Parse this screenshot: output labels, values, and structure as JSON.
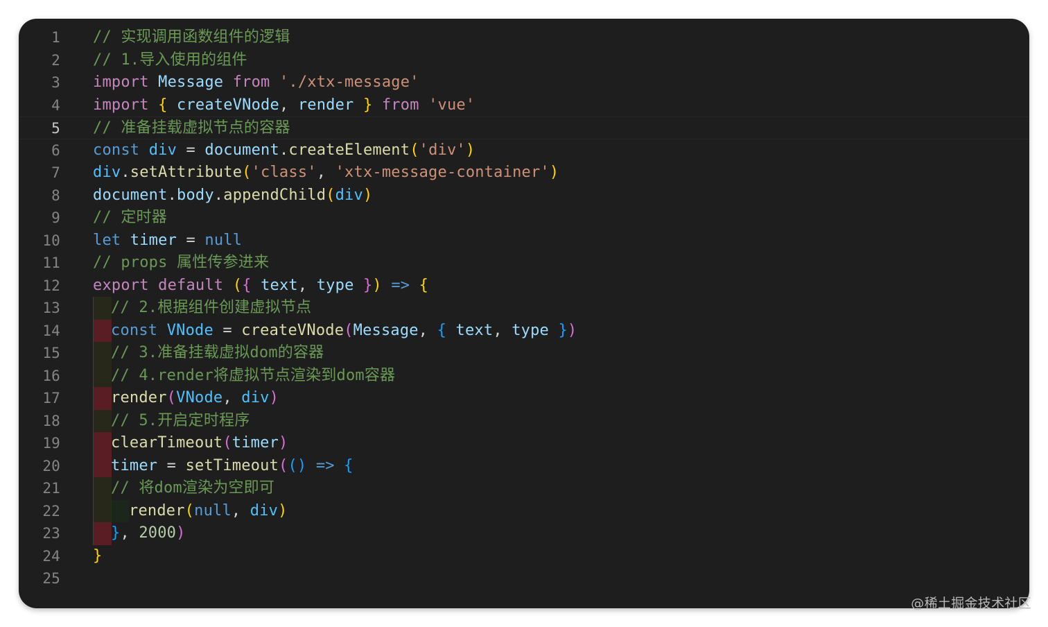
{
  "editor": {
    "lines": [
      {
        "n": "1",
        "indent": 0,
        "tokens": [
          [
            "c",
            "// 实现调用函数组件的逻辑"
          ]
        ]
      },
      {
        "n": "2",
        "indent": 0,
        "tokens": [
          [
            "c",
            "// 1.导入使用的组件"
          ]
        ]
      },
      {
        "n": "3",
        "indent": 0,
        "tokens": [
          [
            "k",
            "import"
          ],
          [
            "p",
            " "
          ],
          [
            "v",
            "Message"
          ],
          [
            "p",
            " "
          ],
          [
            "k",
            "from"
          ],
          [
            "p",
            " "
          ],
          [
            "s",
            "'./xtx-message'"
          ]
        ]
      },
      {
        "n": "4",
        "indent": 0,
        "tokens": [
          [
            "k",
            "import"
          ],
          [
            "p",
            " "
          ],
          [
            "b1",
            "{"
          ],
          [
            "p",
            " "
          ],
          [
            "v",
            "createVNode"
          ],
          [
            "p",
            ", "
          ],
          [
            "v",
            "render"
          ],
          [
            "p",
            " "
          ],
          [
            "b1",
            "}"
          ],
          [
            "p",
            " "
          ],
          [
            "k",
            "from"
          ],
          [
            "p",
            " "
          ],
          [
            "s",
            "'vue'"
          ]
        ]
      },
      {
        "n": "5",
        "indent": 0,
        "current": true,
        "tokens": [
          [
            "c",
            "// 准备挂载虚拟节点的容器"
          ]
        ]
      },
      {
        "n": "6",
        "indent": 0,
        "tokens": [
          [
            "d",
            "const"
          ],
          [
            "p",
            " "
          ],
          [
            "cn",
            "div"
          ],
          [
            "p",
            " = "
          ],
          [
            "v",
            "document"
          ],
          [
            "p",
            "."
          ],
          [
            "f",
            "createElement"
          ],
          [
            "b1",
            "("
          ],
          [
            "s",
            "'div'"
          ],
          [
            "b1",
            ")"
          ]
        ]
      },
      {
        "n": "7",
        "indent": 0,
        "tokens": [
          [
            "cn",
            "div"
          ],
          [
            "p",
            "."
          ],
          [
            "f",
            "setAttribute"
          ],
          [
            "b1",
            "("
          ],
          [
            "s",
            "'class'"
          ],
          [
            "p",
            ", "
          ],
          [
            "s",
            "'xtx-message-container'"
          ],
          [
            "b1",
            ")"
          ]
        ]
      },
      {
        "n": "8",
        "indent": 0,
        "tokens": [
          [
            "v",
            "document"
          ],
          [
            "p",
            "."
          ],
          [
            "v",
            "body"
          ],
          [
            "p",
            "."
          ],
          [
            "f",
            "appendChild"
          ],
          [
            "b1",
            "("
          ],
          [
            "cn",
            "div"
          ],
          [
            "b1",
            ")"
          ]
        ]
      },
      {
        "n": "9",
        "indent": 0,
        "tokens": [
          [
            "c",
            "// 定时器"
          ]
        ]
      },
      {
        "n": "10",
        "indent": 0,
        "tokens": [
          [
            "d",
            "let"
          ],
          [
            "p",
            " "
          ],
          [
            "v",
            "timer"
          ],
          [
            "p",
            " = "
          ],
          [
            "d",
            "null"
          ]
        ]
      },
      {
        "n": "11",
        "indent": 0,
        "tokens": [
          [
            "c",
            "// props 属性传参进来"
          ]
        ]
      },
      {
        "n": "12",
        "indent": 0,
        "tokens": [
          [
            "k",
            "export"
          ],
          [
            "p",
            " "
          ],
          [
            "k",
            "default"
          ],
          [
            "p",
            " "
          ],
          [
            "b1",
            "("
          ],
          [
            "b2",
            "{"
          ],
          [
            "p",
            " "
          ],
          [
            "v",
            "text"
          ],
          [
            "p",
            ", "
          ],
          [
            "v",
            "type"
          ],
          [
            "p",
            " "
          ],
          [
            "b2",
            "}"
          ],
          [
            "b1",
            ")"
          ],
          [
            "p",
            " "
          ],
          [
            "d",
            "=>"
          ],
          [
            "p",
            " "
          ],
          [
            "b1",
            "{"
          ]
        ]
      },
      {
        "n": "13",
        "indent": 1,
        "guide": "normal",
        "tokens": [
          [
            "c",
            "// 2.根据组件创建虚拟节点"
          ]
        ]
      },
      {
        "n": "14",
        "indent": 1,
        "guide": "error",
        "tokens": [
          [
            "d",
            "const"
          ],
          [
            "p",
            " "
          ],
          [
            "cn",
            "VNode"
          ],
          [
            "p",
            " = "
          ],
          [
            "f",
            "createVNode"
          ],
          [
            "b2",
            "("
          ],
          [
            "v",
            "Message"
          ],
          [
            "p",
            ", "
          ],
          [
            "b3",
            "{"
          ],
          [
            "p",
            " "
          ],
          [
            "v",
            "text"
          ],
          [
            "p",
            ", "
          ],
          [
            "v",
            "type"
          ],
          [
            "p",
            " "
          ],
          [
            "b3",
            "}"
          ],
          [
            "b2",
            ")"
          ]
        ]
      },
      {
        "n": "15",
        "indent": 1,
        "guide": "normal",
        "tokens": [
          [
            "c",
            "// 3.准备挂载虚拟dom的容器"
          ]
        ]
      },
      {
        "n": "16",
        "indent": 1,
        "guide": "normal",
        "tokens": [
          [
            "c",
            "// 4.render将虚拟节点渲染到dom容器"
          ]
        ]
      },
      {
        "n": "17",
        "indent": 1,
        "guide": "error",
        "tokens": [
          [
            "f",
            "render"
          ],
          [
            "b2",
            "("
          ],
          [
            "cn",
            "VNode"
          ],
          [
            "p",
            ", "
          ],
          [
            "cn",
            "div"
          ],
          [
            "b2",
            ")"
          ]
        ]
      },
      {
        "n": "18",
        "indent": 1,
        "guide": "normal",
        "tokens": [
          [
            "c",
            "// 5.开启定时程序"
          ]
        ]
      },
      {
        "n": "19",
        "indent": 1,
        "guide": "error",
        "tokens": [
          [
            "f",
            "clearTimeout"
          ],
          [
            "b2",
            "("
          ],
          [
            "v",
            "timer"
          ],
          [
            "b2",
            ")"
          ]
        ]
      },
      {
        "n": "20",
        "indent": 1,
        "guide": "error",
        "tokens": [
          [
            "v",
            "timer"
          ],
          [
            "p",
            " = "
          ],
          [
            "f",
            "setTimeout"
          ],
          [
            "b2",
            "("
          ],
          [
            "b3",
            "()"
          ],
          [
            "p",
            " "
          ],
          [
            "d",
            "=>"
          ],
          [
            "p",
            " "
          ],
          [
            "b3",
            "{"
          ]
        ]
      },
      {
        "n": "21",
        "indent": 1,
        "guide": "normal",
        "tokens": [
          [
            "c",
            "// 将dom渲染为空即可"
          ]
        ]
      },
      {
        "n": "22",
        "indent": 2,
        "guide": "normal",
        "tokens": [
          [
            "f",
            "render"
          ],
          [
            "b1",
            "("
          ],
          [
            "d",
            "null"
          ],
          [
            "p",
            ", "
          ],
          [
            "cn",
            "div"
          ],
          [
            "b1",
            ")"
          ]
        ]
      },
      {
        "n": "23",
        "indent": 1,
        "guide": "error",
        "tokens": [
          [
            "b3",
            "}"
          ],
          [
            "p",
            ", "
          ],
          [
            "n",
            "2000"
          ],
          [
            "b2",
            ")"
          ]
        ]
      },
      {
        "n": "24",
        "indent": 0,
        "tokens": [
          [
            "b1",
            "}"
          ]
        ]
      },
      {
        "n": "25",
        "indent": 0,
        "tokens": []
      }
    ]
  },
  "watermark": "@稀土掘金技术社区"
}
